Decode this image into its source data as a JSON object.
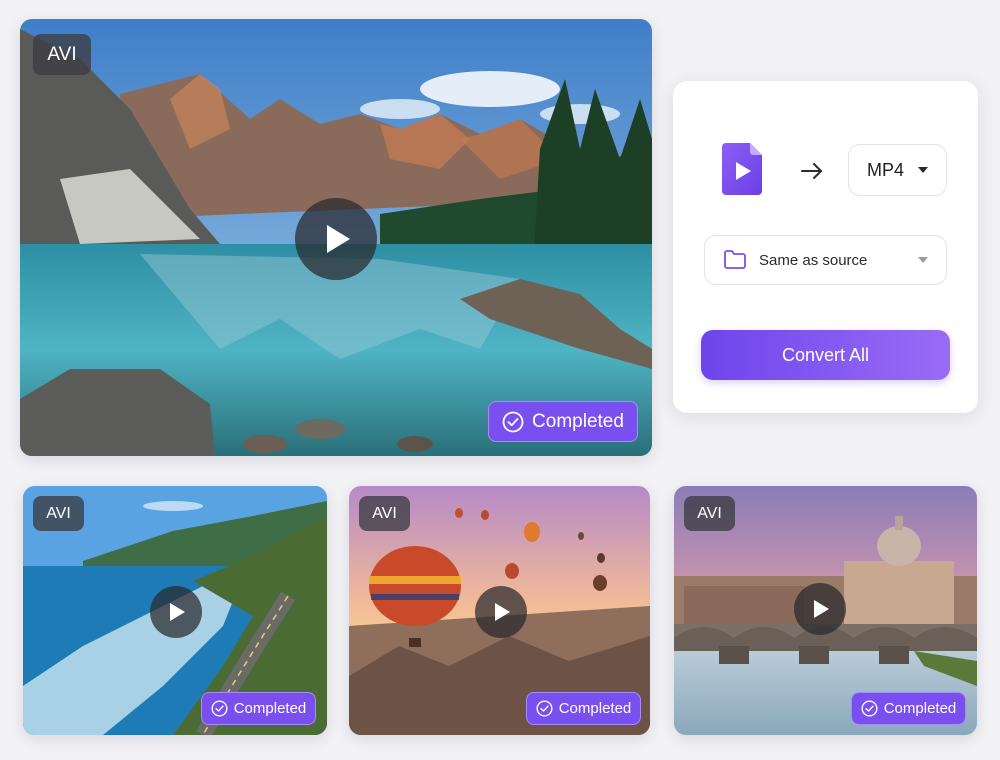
{
  "hero": {
    "format": "AVI",
    "status": "Completed",
    "thumbnail_icon": "mountain-lake-landscape"
  },
  "thumbnails": [
    {
      "format": "AVI",
      "status": "Completed",
      "thumbnail_icon": "coastal-road-landscape"
    },
    {
      "format": "AVI",
      "status": "Completed",
      "thumbnail_icon": "hot-air-balloons-landscape"
    },
    {
      "format": "AVI",
      "status": "Completed",
      "thumbnail_icon": "river-bridge-city-landscape"
    }
  ],
  "converter": {
    "source_icon": "video-file-icon",
    "arrow_icon": "arrow-right-icon",
    "target_format": "MP4",
    "output_folder_icon": "folder-icon",
    "output_folder": "Same as source",
    "convert_label": "Convert All"
  },
  "colors": {
    "accent": "#7a4ff0",
    "accent_light": "#9a6cf5",
    "badge_dark": "#3c3c42",
    "background": "#f2f2f5"
  }
}
